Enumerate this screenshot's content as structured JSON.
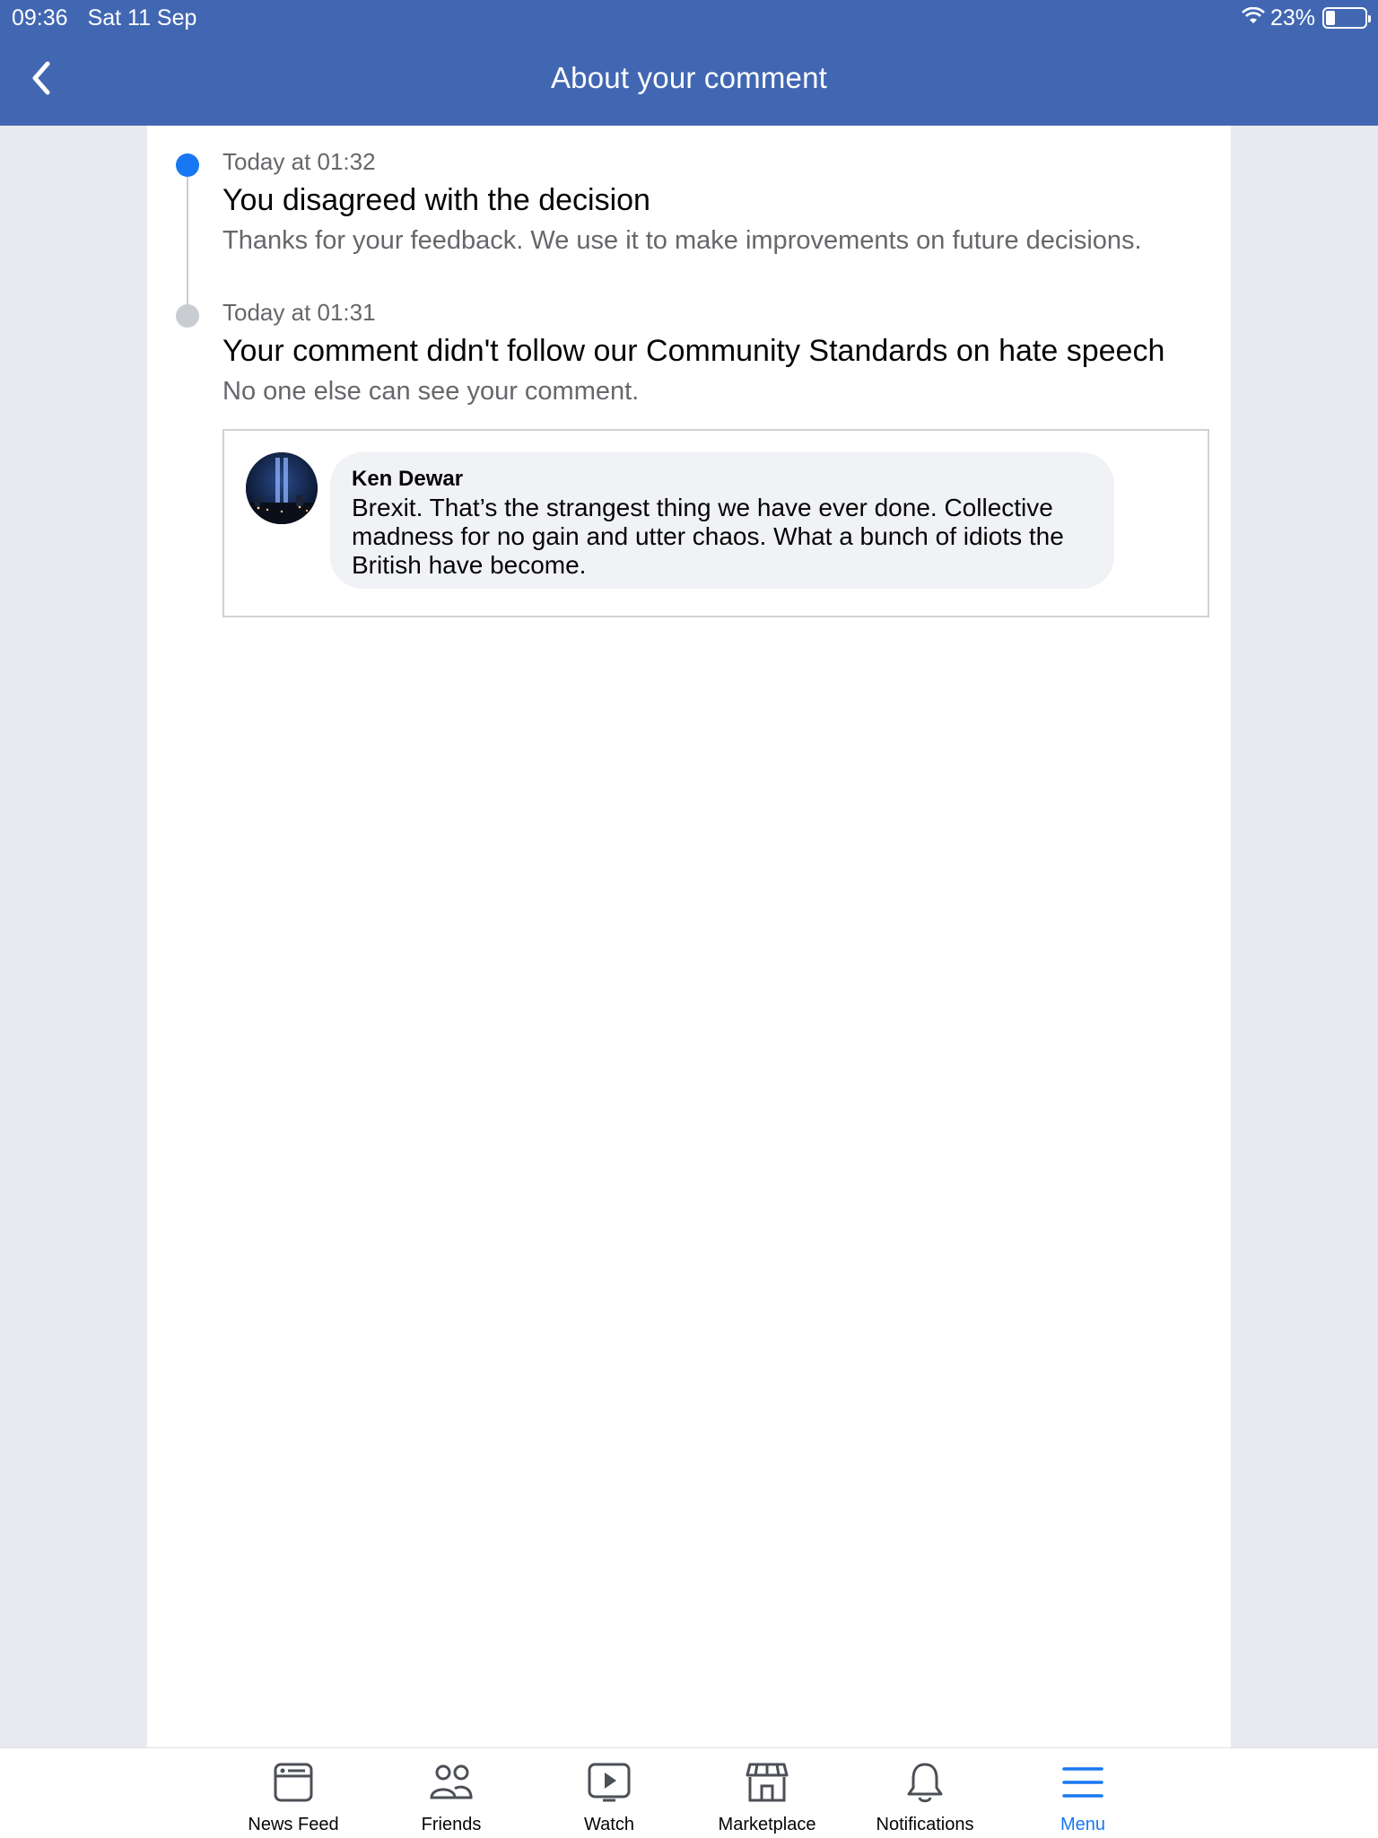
{
  "status_bar": {
    "time": "09:36",
    "date": "Sat 11 Sep",
    "battery": "23%",
    "battery_level": 0.23
  },
  "header": {
    "title": "About your comment",
    "back_icon": "chevron-left-icon"
  },
  "timeline": [
    {
      "time": "Today at 01:32",
      "title": "You disagreed with the decision",
      "description": "Thanks for your feedback. We use it to make improvements on future decisions.",
      "status_color": "#1877f2"
    },
    {
      "time": "Today at 01:31",
      "title": "Your comment didn't follow our Community Standards on hate speech",
      "description": "No one else can see your comment.",
      "status_color": "#c9ccd1"
    }
  ],
  "comment": {
    "author": "Ken Dewar",
    "text": "Brexit. That’s the strangest thing we have ever done. Collective madness for no gain and utter chaos. What a bunch of idiots the British have become."
  },
  "tabbar": {
    "items": [
      {
        "label": "News Feed",
        "icon": "news-feed-icon"
      },
      {
        "label": "Friends",
        "icon": "friends-icon"
      },
      {
        "label": "Watch",
        "icon": "watch-icon"
      },
      {
        "label": "Marketplace",
        "icon": "marketplace-icon"
      },
      {
        "label": "Notifications",
        "icon": "bell-icon"
      },
      {
        "label": "Menu",
        "icon": "menu-icon",
        "active": true
      }
    ]
  },
  "colors": {
    "header": "#4267b2",
    "accent": "#1877f2",
    "background": "#e9eaef"
  }
}
